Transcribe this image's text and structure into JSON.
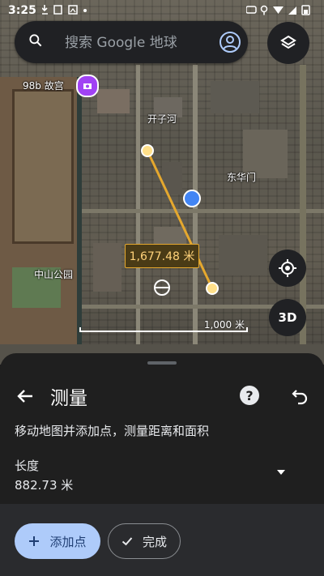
{
  "status_bar": {
    "time": "3:25",
    "left_icons": [
      "download-icon",
      "notification-icon",
      "image-icon",
      "dot"
    ],
    "right_icons": [
      "vpn-icon",
      "location-icon",
      "wifi-icon",
      "signal-icon",
      "battery-icon"
    ]
  },
  "search": {
    "placeholder": "搜索 Google 地球"
  },
  "map": {
    "labels": {
      "place_1": "98b 故宫",
      "place_2": "开子河",
      "place_3": "东华门",
      "place_4": "中山公园"
    },
    "measurement_label": "1,677.48 米",
    "scale_label": "1,000 米",
    "btn_3d": "3D"
  },
  "sheet": {
    "title": "测量",
    "instructions": "移动地图并添加点，测量距离和面积",
    "metric_label": "长度",
    "metric_value": "882.73 米",
    "add_point_label": "添加点",
    "done_label": "完成"
  },
  "colors": {
    "accent": "#aecbfa",
    "measure_line": "#e5a82e",
    "location_dot": "#4285f4",
    "sheet_bg": "#1f1f1f"
  }
}
